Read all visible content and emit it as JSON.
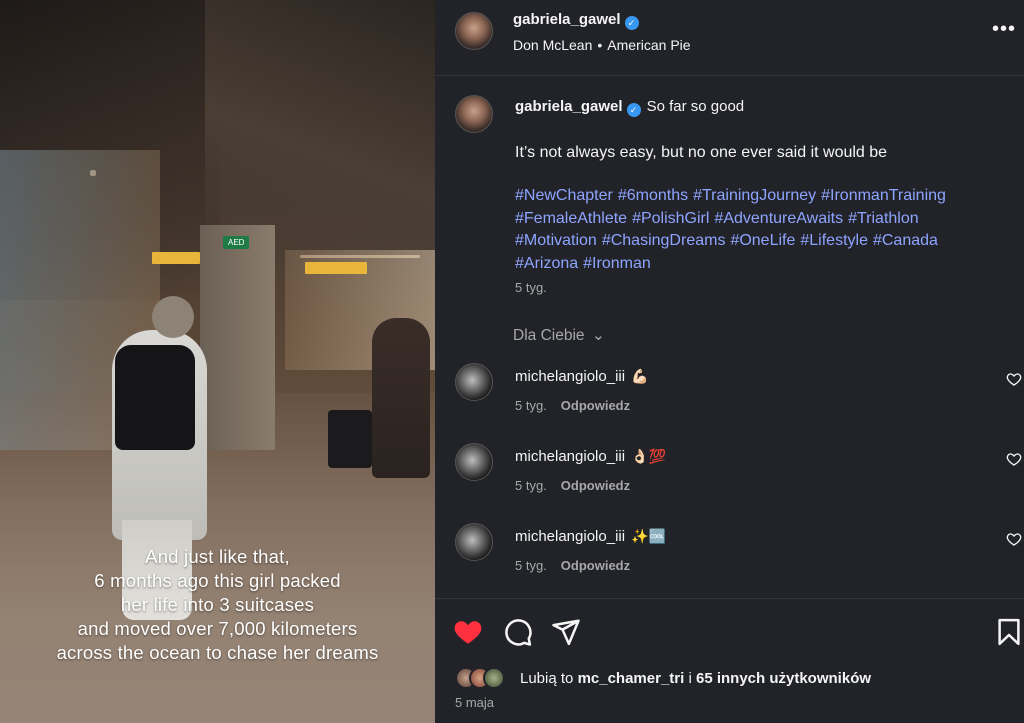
{
  "media": {
    "signs": {
      "aed": "AED"
    },
    "caption_lines": [
      "And just like that,",
      "6 months ago this girl packed",
      "her life into 3 suitcases",
      "and moved over 7,000 kilometers",
      "across the ocean to chase her dreams"
    ]
  },
  "header": {
    "username": "gabriela_gawel",
    "verified": true,
    "audio_artist": "Don McLean",
    "audio_separator": "•",
    "audio_track": "American Pie",
    "more_label": "•••"
  },
  "caption": {
    "username": "gabriela_gawel",
    "title": "So far so good",
    "body": "It’s not always easy, but no one ever said it would be",
    "hashtags": [
      "#NewChapter",
      "#6months",
      "#TrainingJourney",
      "#IronmanTraining",
      "#FemaleAthlete",
      "#PolishGirl",
      "#AdventureAwaits",
      "#Triathlon",
      "#Motivation",
      "#ChasingDreams",
      "#OneLife",
      "#Lifestyle",
      "#Canada",
      "#Arizona",
      "#Ironman"
    ],
    "time": "5 tyg."
  },
  "for_you": {
    "label": "Dla Ciebie",
    "chevron": "⌄"
  },
  "comments": [
    {
      "username": "michelangiolo_iii",
      "emoji": "💪🏻",
      "time": "5 tyg.",
      "reply_label": "Odpowiedz"
    },
    {
      "username": "michelangiolo_iii",
      "emoji": "👌🏻💯",
      "time": "5 tyg.",
      "reply_label": "Odpowiedz"
    },
    {
      "username": "michelangiolo_iii",
      "emoji": "✨🆒",
      "time": "5 tyg.",
      "reply_label": "Odpowiedz"
    }
  ],
  "likes": {
    "prefix": "Lubią to",
    "user": "mc_chamer_tri",
    "connector": "i",
    "others": "65 innych użytkowników"
  },
  "post_date": "5 maja",
  "colors": {
    "panel_bg": "#212328",
    "hashtag": "#8ea4ff",
    "verified": "#3897f0",
    "like_red": "#ff3040",
    "muted": "#a8a8a8"
  },
  "icons": {
    "like": "heart-filled",
    "comment": "speech-bubble",
    "share": "paper-plane",
    "save": "bookmark"
  }
}
